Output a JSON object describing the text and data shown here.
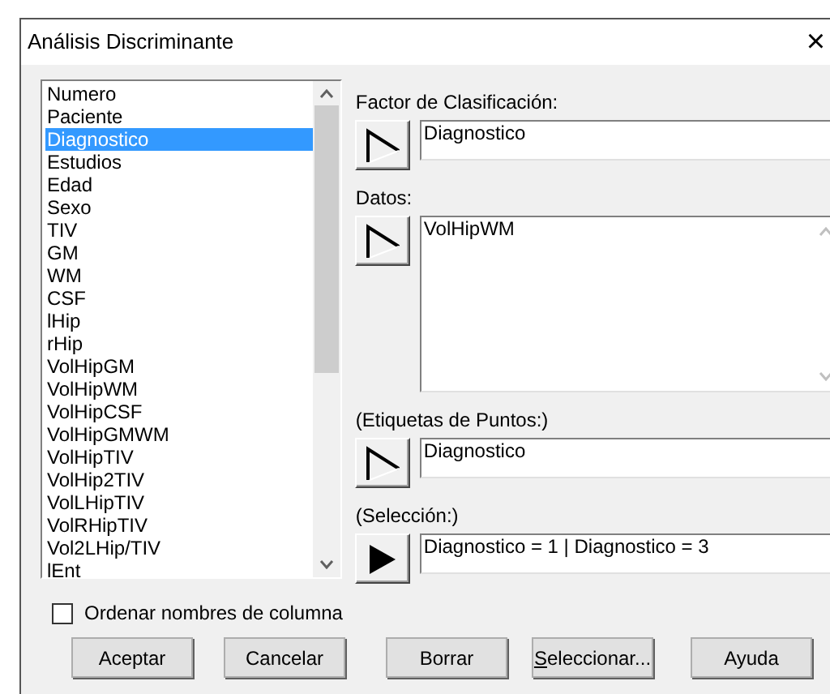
{
  "window": {
    "title": "Análisis Discriminante",
    "close": "×"
  },
  "columns": [
    {
      "label": "Numero",
      "selected": false
    },
    {
      "label": "Paciente",
      "selected": false
    },
    {
      "label": "Diagnostico",
      "selected": true
    },
    {
      "label": "Estudios",
      "selected": false
    },
    {
      "label": "Edad",
      "selected": false
    },
    {
      "label": "Sexo",
      "selected": false
    },
    {
      "label": "TIV",
      "selected": false
    },
    {
      "label": "GM",
      "selected": false
    },
    {
      "label": "WM",
      "selected": false
    },
    {
      "label": "CSF",
      "selected": false
    },
    {
      "label": "lHip",
      "selected": false
    },
    {
      "label": "rHip",
      "selected": false
    },
    {
      "label": "VolHipGM",
      "selected": false
    },
    {
      "label": "VolHipWM",
      "selected": false
    },
    {
      "label": "VolHipCSF",
      "selected": false
    },
    {
      "label": "VolHipGMWM",
      "selected": false
    },
    {
      "label": "VolHipTIV",
      "selected": false
    },
    {
      "label": "VolHip2TIV",
      "selected": false
    },
    {
      "label": "VolLHipTIV",
      "selected": false
    },
    {
      "label": "VolRHipTIV",
      "selected": false
    },
    {
      "label": "Vol2LHip/TIV",
      "selected": false
    },
    {
      "label": "lEnt",
      "selected": false
    }
  ],
  "fields": [
    {
      "label": "Factor de Clasificación:",
      "kind": "line",
      "button": {
        "kind": "outline"
      },
      "value": "Diagnostico"
    },
    {
      "label": "Datos:",
      "kind": "multiline",
      "button": {
        "kind": "outline"
      },
      "value": "VolHipWM"
    },
    {
      "label": "(Etiquetas de Puntos:)",
      "kind": "line",
      "button": {
        "kind": "outline"
      },
      "value": "Diagnostico"
    },
    {
      "label": "(Selección:)",
      "kind": "line",
      "button": {
        "kind": "filled"
      },
      "value": "Diagnostico = 1 | Diagnostico = 3"
    }
  ],
  "sort_checkbox": {
    "label": "Ordenar nombres de columna",
    "checked": false
  },
  "buttons": [
    {
      "label": "Aceptar",
      "underline_first": false
    },
    {
      "label": "Cancelar",
      "underline_first": false
    },
    {
      "label": "Borrar",
      "underline_first": false
    },
    {
      "label": "Seleccionar...",
      "underline_first": true
    },
    {
      "label": "Ayuda",
      "underline_first": false
    }
  ]
}
